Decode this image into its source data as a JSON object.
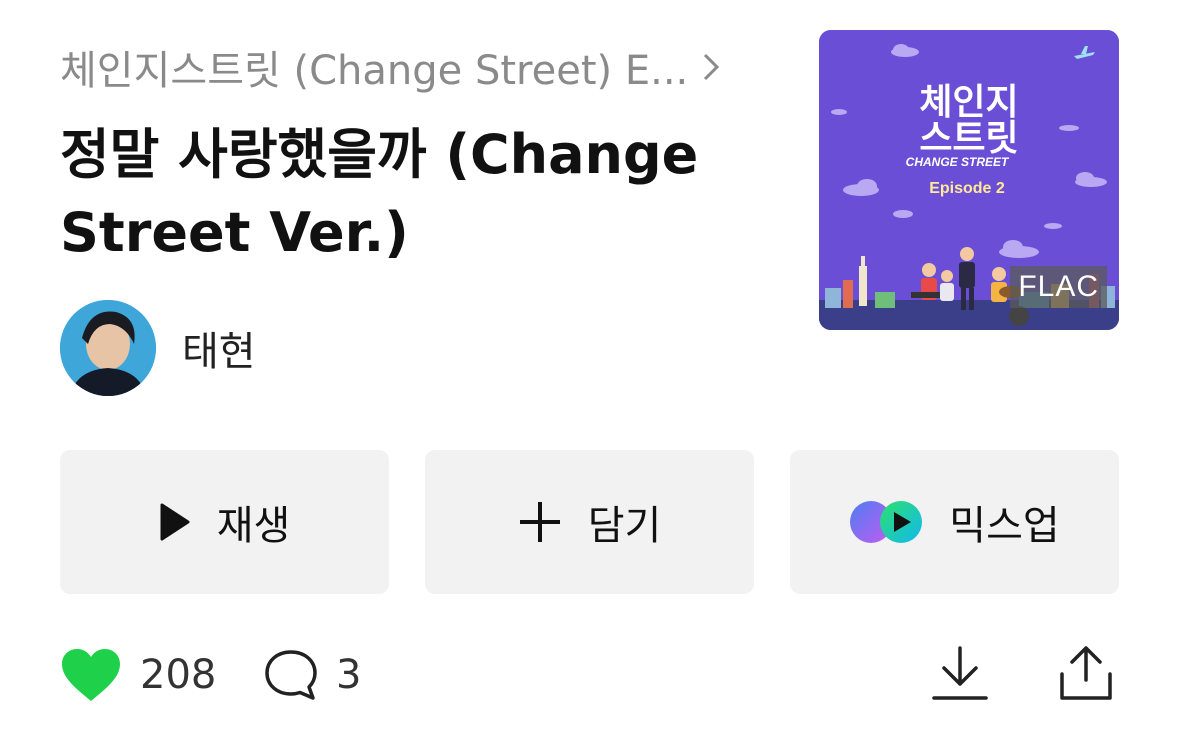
{
  "album": {
    "breadcrumb": "체인지스트릿 (Change Street) E...",
    "art_badge": "FLAC",
    "art_text": {
      "logo_line1": "체인지",
      "logo_line2": "스트릿",
      "logo_sub": "CHANGE STREET",
      "episode": "Episode 2"
    },
    "art_bg_color": "#6a4fd6"
  },
  "song": {
    "title": "정말 사랑했을까 (Change Street Ver.)"
  },
  "artist": {
    "name": "태현"
  },
  "actions": {
    "play_label": "재생",
    "add_label": "담기",
    "mixup_label": "믹스업"
  },
  "stats": {
    "likes": "208",
    "comments": "3"
  },
  "colors": {
    "like_heart": "#1ed04a",
    "muted_text": "#8a8a8a",
    "button_bg": "#f2f2f2"
  },
  "icons": {
    "breadcrumb": "chevron-right-icon",
    "play": "play-icon",
    "add": "plus-icon",
    "mixup": "mixup-icon",
    "like": "heart-icon",
    "comment": "comment-icon",
    "download": "download-icon",
    "share": "share-icon"
  }
}
